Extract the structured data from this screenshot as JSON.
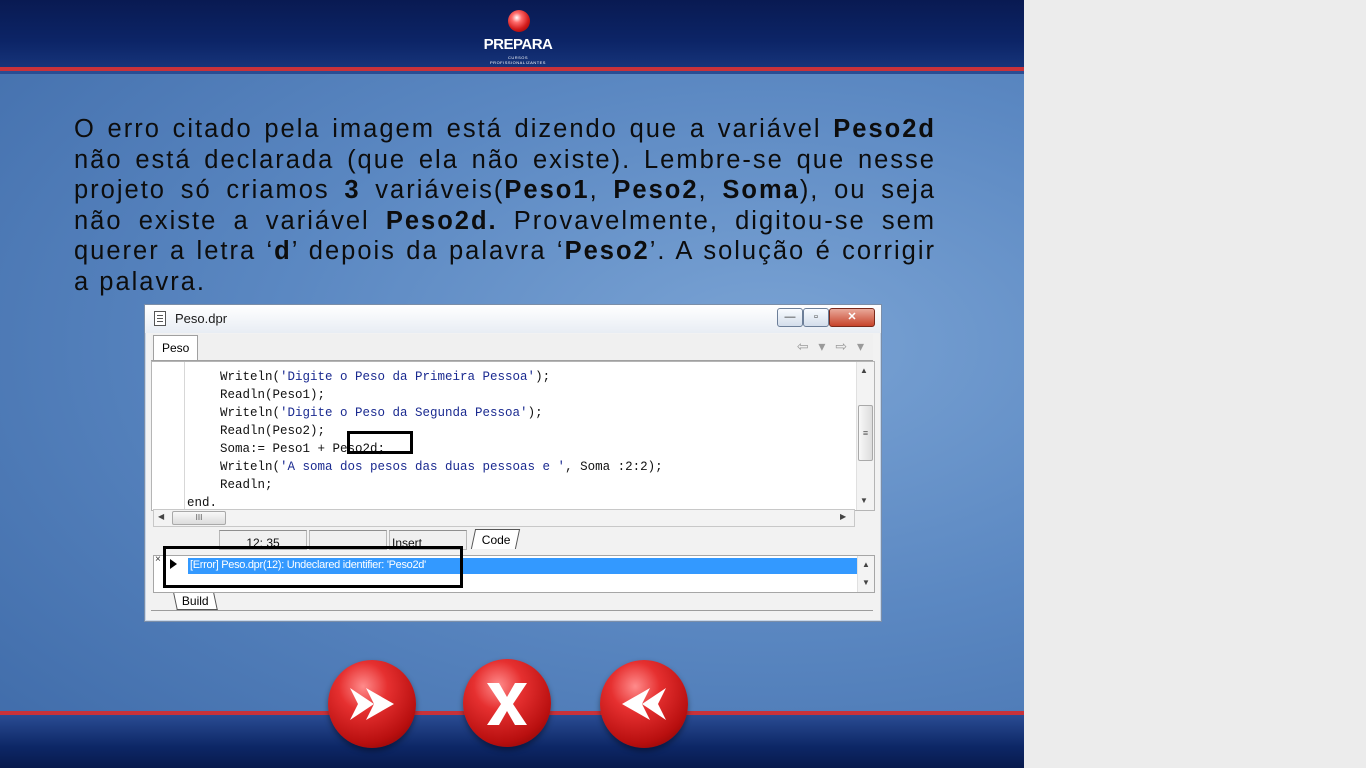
{
  "slide": {
    "logo": {
      "name": "PREPARA",
      "tagline": "CURSOS PROFISSIONALIZANTES"
    },
    "paragraph": [
      {
        "t": "O erro citado pela imagem está dizendo que a variável ",
        "b": false
      },
      {
        "t": "Peso2d",
        "b": true
      },
      {
        "t": " não está declarada (que ela não existe). Lembre-se que nesse projeto só criamos ",
        "b": false
      },
      {
        "t": "3",
        "b": true
      },
      {
        "t": " variáveis(",
        "b": false
      },
      {
        "t": "Peso1",
        "b": true
      },
      {
        "t": ", ",
        "b": false
      },
      {
        "t": "Peso2",
        "b": true
      },
      {
        "t": ", ",
        "b": false
      },
      {
        "t": "Soma",
        "b": true
      },
      {
        "t": "), ou seja não existe a variável ",
        "b": false
      },
      {
        "t": "Peso2d.",
        "b": true
      },
      {
        "t": " Provavelmente, digitou-se  sem querer a letra ‘",
        "b": false
      },
      {
        "t": "d",
        "b": true
      },
      {
        "t": "’ depois da palavra ‘",
        "b": false
      },
      {
        "t": "Peso2",
        "b": true
      },
      {
        "t": "’. A solução é corrigir a palavra.",
        "b": false
      }
    ]
  },
  "ide": {
    "window_title": "Peso.dpr",
    "window_buttons": {
      "minimize": "—",
      "maximize": "▫",
      "close": "✕"
    },
    "editor_tab": "Peso",
    "nav_arrows": "⇦ ▾ ⇨ ▾",
    "code_lines": [
      {
        "indent": "    ",
        "parts": [
          {
            "t": "Writeln(",
            "s": false
          },
          {
            "t": "'Digite o Peso da Primeira Pessoa'",
            "s": true
          },
          {
            "t": ");",
            "s": false
          }
        ]
      },
      {
        "indent": "    ",
        "parts": [
          {
            "t": "Readln(Peso1);",
            "s": false
          }
        ]
      },
      {
        "indent": "    ",
        "parts": [
          {
            "t": "Writeln(",
            "s": false
          },
          {
            "t": "'Digite o Peso da Segunda Pessoa'",
            "s": true
          },
          {
            "t": ");",
            "s": false
          }
        ]
      },
      {
        "indent": "    ",
        "parts": [
          {
            "t": "Readln(Peso2);",
            "s": false
          }
        ]
      },
      {
        "indent": "    ",
        "parts": [
          {
            "t": "Soma:= Peso1 + Peso2d;",
            "s": false
          }
        ]
      },
      {
        "indent": "    ",
        "parts": [
          {
            "t": "Writeln(",
            "s": false
          },
          {
            "t": "'A soma dos pesos das duas pessoas e '",
            "s": true
          },
          {
            "t": ", Soma :2:2);",
            "s": false
          }
        ]
      },
      {
        "indent": "    ",
        "parts": [
          {
            "t": "Readln;",
            "s": false
          }
        ]
      },
      {
        "indent": "",
        "parts": [
          {
            "t": "end.",
            "s": false
          }
        ]
      }
    ],
    "scrollbar_grip": "≡",
    "hscroll_grip": "III",
    "status": {
      "position": "12: 35",
      "mode": "Insert",
      "code_tab": "Code"
    },
    "message": "[Error] Peso.dpr(12): Undeclared identifier: 'Peso2d'",
    "build_tab": "Build",
    "close_glyph": "×"
  },
  "colors": {
    "header": "#0c2466",
    "accent_red": "#c8323a",
    "selection": "#3399ff",
    "string_literal": "#1a2a90"
  },
  "nav": {
    "next_icon": "forward-arrow-icon",
    "exit_icon": "x-icon",
    "prev_icon": "back-arrow-icon"
  }
}
